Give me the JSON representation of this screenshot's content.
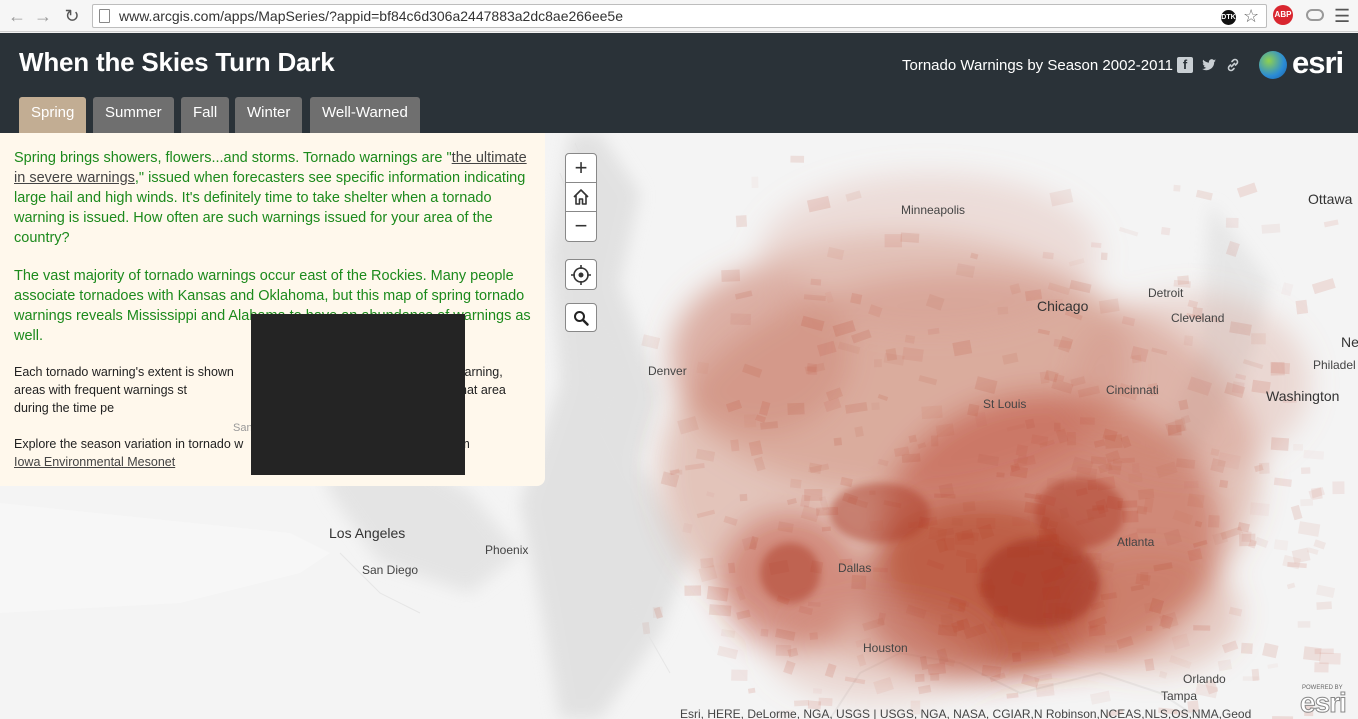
{
  "browser": {
    "url": "www.arcgis.com/apps/MapSeries/?appid=bf84c6d306a2447883a2dc8ae266ee5e",
    "abp_label": "ABP",
    "ext_label": "DTK"
  },
  "header": {
    "title": "When the Skies Turn Dark",
    "subtitle": "Tornado Warnings by Season 2002-2011",
    "logo_text": "esri"
  },
  "tabs": [
    {
      "label": "Spring",
      "active": true
    },
    {
      "label": "Summer",
      "active": false
    },
    {
      "label": "Fall",
      "active": false
    },
    {
      "label": "Winter",
      "active": false
    },
    {
      "label": "Well-Warned",
      "active": false
    }
  ],
  "panel": {
    "p1_before": "Spring brings showers, flowers...and storms. Tornado warnings are \"",
    "p1_link": "the ultimate in severe warnings",
    "p1_after": ",\" issued when forecasters see specific information indicating large hail and high winds. It's definitely time to take shelter when a tornado warning is issued. How often are such warnings issued for your area of the country?",
    "p2": "The vast majority of tornado warnings occur east of the Rockies. Many people associate tornadoes with Kansas and Oklahoma, but this map of spring tornado warnings reveals Mississippi and Alabama to have an abundance of warnings as well.",
    "p3": "Each tornado warning's extent is shown                                                    n each warning, areas with frequent warnings st                                                   the warnings for that area during the time pe",
    "p4_before": "Explore the season variation in tornado w                                                    ata from",
    "p4_link": "Iowa Environmental Mesonet"
  },
  "map": {
    "controls": {
      "zoom_in": "+",
      "zoom_out": "−"
    },
    "cities": [
      "Minneapolis",
      "Ottawa",
      "Chicago",
      "Detroit",
      "Cleveland",
      "Denver",
      "St Louis",
      "Cincinnati",
      "Washington",
      "Ne",
      "Philadel",
      "Los Angeles",
      "Phoenix",
      "San Diego",
      "Dallas",
      "Atlanta",
      "Houston",
      "Orlando",
      "Tampa",
      "San"
    ],
    "attribution": "Esri, HERE, DeLorme, NGA, USGS | USGS, NGA, NASA, CGIAR,N Robinson,NCEAS,NLS,OS,NMA,Geod",
    "powered_by": "POWERED BY",
    "powered_logo": "esri",
    "warning_color": "#b5341a"
  }
}
